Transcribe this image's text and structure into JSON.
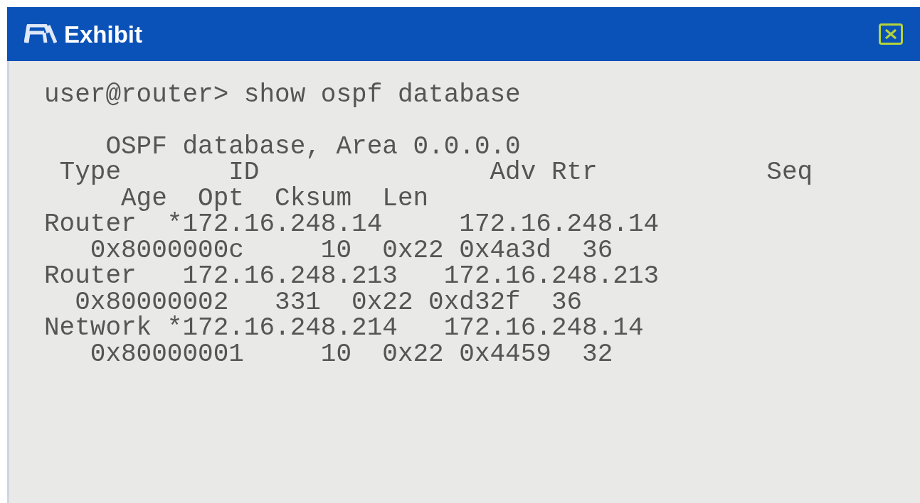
{
  "window": {
    "title": "Exhibit"
  },
  "terminal": {
    "command": "user@router> show ospf database",
    "output": [
      "    OSPF database, Area 0.0.0.0",
      " Type       ID               Adv Rtr           Seq",
      "     Age  Opt  Cksum  Len",
      "Router  *172.16.248.14     172.16.248.14",
      "   0x8000000c     10  0x22 0x4a3d  36",
      "Router   172.16.248.213   172.16.248.213",
      "  0x80000002   331  0x22 0xd32f  36",
      "Network *172.16.248.214   172.16.248.14",
      "   0x80000001     10  0x22 0x4459  32"
    ]
  }
}
